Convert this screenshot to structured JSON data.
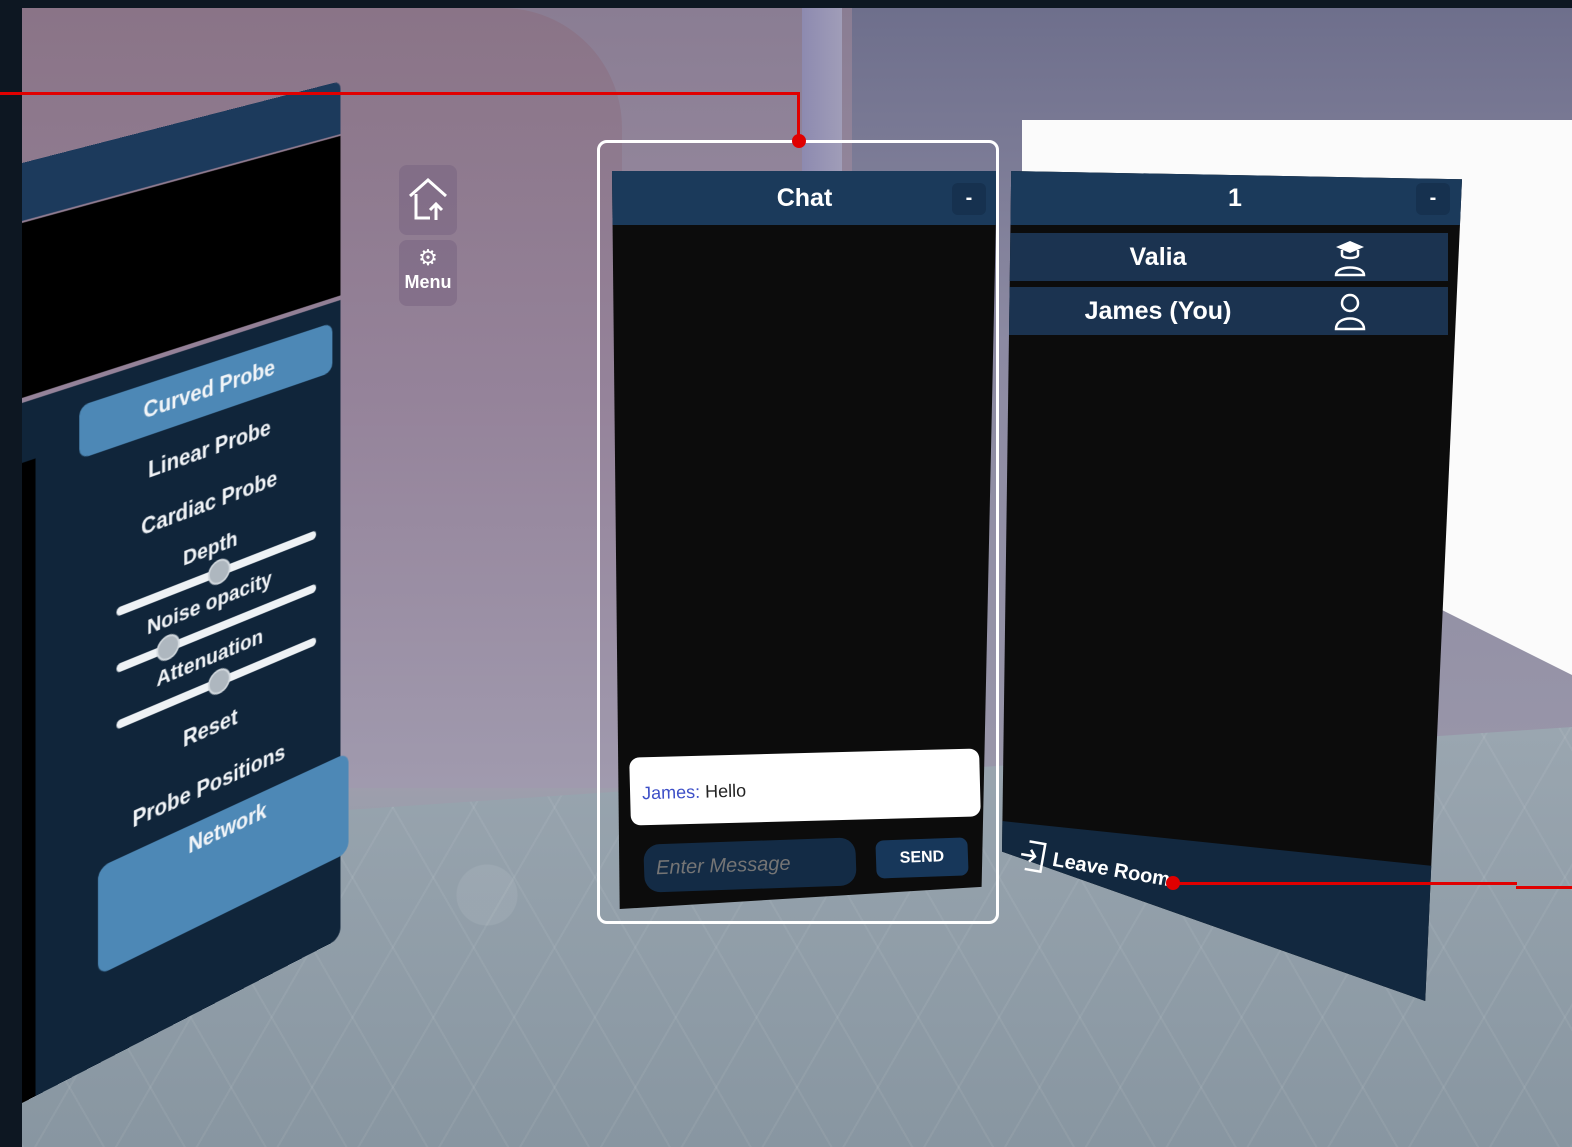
{
  "left_panel": {
    "buttons": [
      "Curved Probe",
      "Linear Probe",
      "Cardiac Probe"
    ],
    "sliders": [
      {
        "label": "Depth",
        "value": 0.5
      },
      {
        "label": "Noise opacity",
        "value": 0.25
      },
      {
        "label": "Attenuation",
        "value": 0.5
      }
    ],
    "reset_label": "Reset",
    "probe_positions_label": "Probe Positions",
    "network_label": "Network"
  },
  "menu": {
    "label": "Menu"
  },
  "chat": {
    "title": "Chat",
    "minimize_label": "-",
    "messages": [
      {
        "sender": "James:",
        "text": "Hello"
      }
    ],
    "input_placeholder": "Enter Message",
    "send_label": "SEND"
  },
  "room": {
    "title": "1",
    "minimize_label": "-",
    "users": [
      {
        "name": "Valia",
        "icon": "teacher-icon"
      },
      {
        "name": "James (You)",
        "icon": "user-icon"
      }
    ],
    "leave_label": "Leave Room"
  },
  "colors": {
    "panel_header": "#1b3a5b",
    "accent": "#4d88b6",
    "callout": "#e00000",
    "highlight": "#ffffff"
  }
}
